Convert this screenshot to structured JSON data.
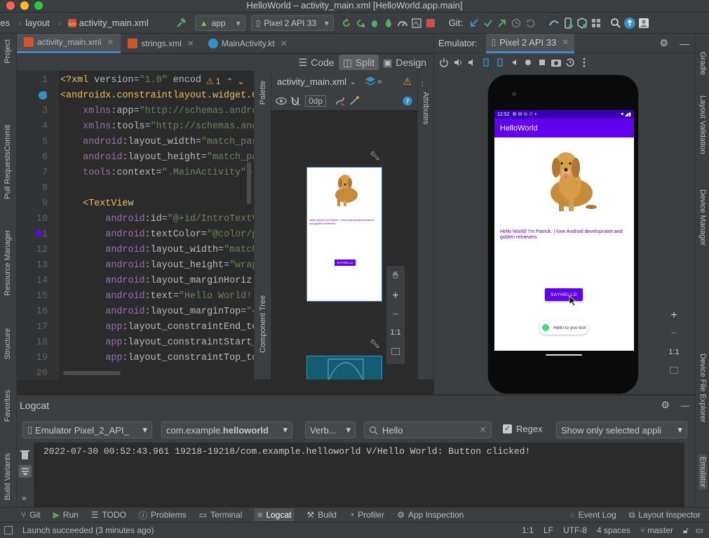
{
  "window": {
    "title": "HelloWorld – activity_main.xml [HelloWorld.app.main]"
  },
  "toolbar": {
    "crumbs": [
      "res",
      "layout",
      "activity_main.xml"
    ],
    "run_config": "app",
    "device": "Pixel 2 API 33",
    "git_label": "Git:"
  },
  "editor": {
    "tabs": [
      {
        "label": "activity_main.xml",
        "active": true
      },
      {
        "label": "strings.xml",
        "active": false
      },
      {
        "label": "MainActivity.kt",
        "active": false
      }
    ],
    "modes": [
      {
        "label": "Code"
      },
      {
        "label": "Split",
        "active": true
      },
      {
        "label": "Design"
      }
    ],
    "warning_count": "1",
    "line_numbers": [
      "1",
      "2",
      "3",
      "4",
      "5",
      "6",
      "7",
      "8",
      "9",
      "10",
      "11",
      "12",
      "13",
      "14",
      "15",
      "16",
      "17",
      "18",
      "19",
      "20"
    ],
    "lines": [
      "<?xml version=\"1.0\" encod",
      "<androidx.constraintlayout.widget.C",
      "    xmlns:app=\"http://schemas.andro",
      "    xmlns:tools=\"http://schemas.and",
      "    android:layout_width=\"match_par",
      "    android:layout_height=\"match_pa",
      "    tools:context=\".MainActivity\">",
      "",
      "    <TextView",
      "        android:id=\"@+id/IntroTextV",
      "        android:textColor=\"@color/p",
      "        android:layout_width=\"match",
      "        android:layout_height=\"wrap",
      "        android:layout_marginHoriz",
      "        android:text=\"Hello World! ",
      "        android:layout_marginTop=\"4",
      "        app:layout_constraintEnd_to",
      "        app:layout_constraintStart_",
      "        app:layout_constraintTop_to",
      ""
    ]
  },
  "design": {
    "file_dropdown": "activity_main.xml",
    "margin": "0dp",
    "ratio": "1:1",
    "preview_text": "Hello World! I'm Patrick. I love Android development and golden retrievers.",
    "preview_button": "SAYHELLO"
  },
  "side_tabs": {
    "left": [
      "Project",
      "Commit",
      "Pull Requests",
      "Resource Manager",
      "Structure",
      "Favorites",
      "Build Variants"
    ],
    "right": [
      "Gradle",
      "Layout Validation",
      "Device Manager",
      "Device File Explorer",
      "Emulator"
    ],
    "palette": "Palette",
    "component_tree": "Component Tree",
    "attributes": "Attributes"
  },
  "emulator": {
    "label": "Emulator:",
    "tab": "Pixel 2 API 33",
    "phone": {
      "time": "12:52",
      "app_title": "HelloWorld",
      "message": "Hello World! I'm Patrick. I love Android development and golden retrievers.",
      "button": "SAYHELLO",
      "toast": "Hello to you too!"
    },
    "zoom_ratio": "1:1",
    "colors": {
      "app_bar": "#6200ee",
      "button": "#6200ee",
      "text": "#6200ee"
    }
  },
  "logcat": {
    "title": "Logcat",
    "device": "Emulator Pixel_2_API_",
    "package_prefix": "com.example.",
    "package_bold": "helloworld",
    "level": "Verb...",
    "search": "Hello",
    "regex_label": "Regex",
    "regex_checked": true,
    "scope": "Show only selected appli",
    "lines": [
      "2022-07-30 00:52:43.961 19218-19218/com.example.helloworld V/Hello World: Button clicked!"
    ]
  },
  "bottom_tools": [
    {
      "label": "Git"
    },
    {
      "label": "Run"
    },
    {
      "label": "TODO"
    },
    {
      "label": "Problems"
    },
    {
      "label": "Terminal"
    },
    {
      "label": "Logcat",
      "active": true
    },
    {
      "label": "Build"
    },
    {
      "label": "Profiler"
    },
    {
      "label": "App Inspection"
    }
  ],
  "bottom_right_tools": [
    {
      "label": "Event Log"
    },
    {
      "label": "Layout Inspector"
    }
  ],
  "status": {
    "message": "Launch succeeded (3 minutes ago)",
    "position": "1:1",
    "line_sep": "LF",
    "encoding": "UTF-8",
    "indent": "4 spaces",
    "branch": "master"
  }
}
